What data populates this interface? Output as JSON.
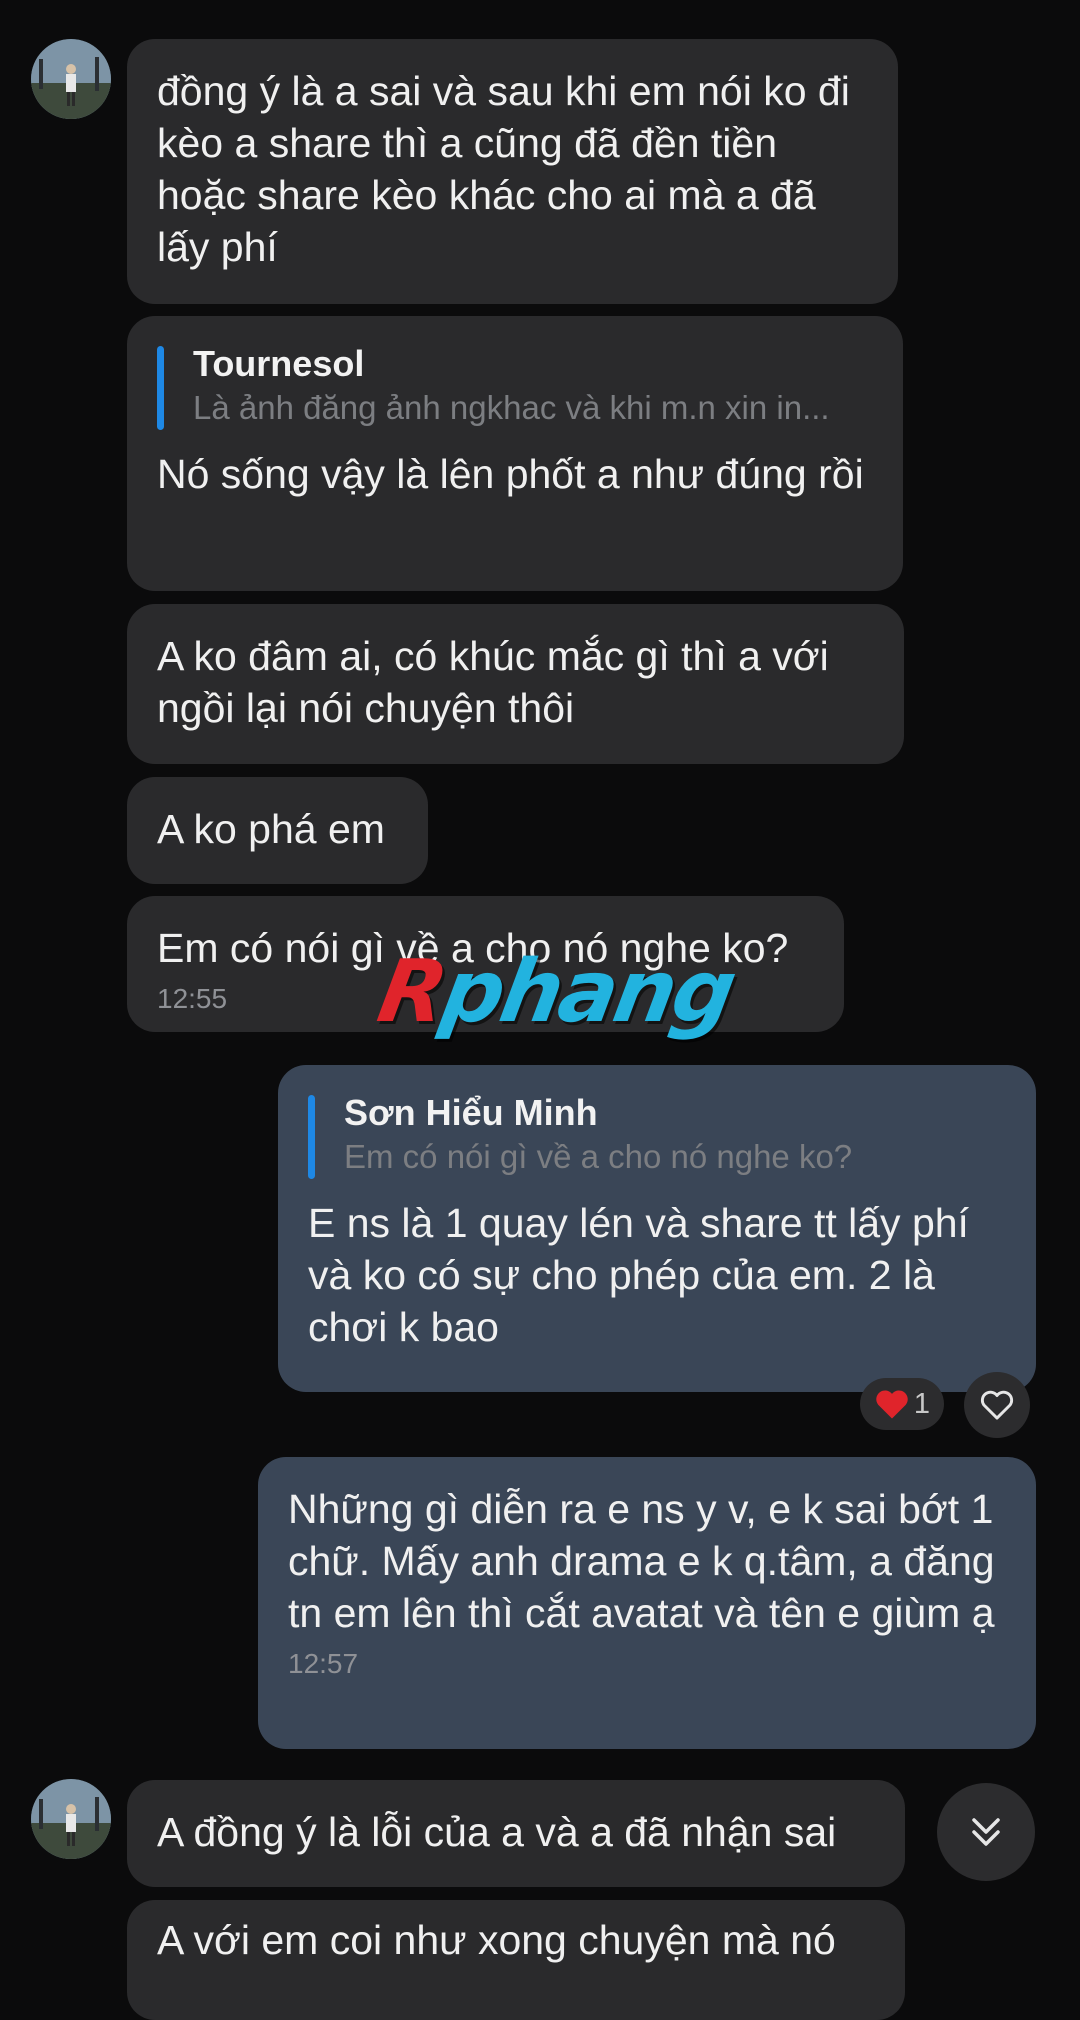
{
  "messages": [
    {
      "text": "đồng ý là a sai và sau khi em nói ko đi kèo a share thì a cũng đã đền tiền hoặc share kèo khác cho ai mà a đã lấy phí"
    },
    {
      "quote_name": "Tournesol",
      "quote_text": "Là ảnh đăng ảnh ngkhac và khi m.n xin in...",
      "text": "Nó sống vậy là lên phốt a như đúng rồi"
    },
    {
      "text": "A ko đâm ai, có khúc mắc gì thì a với ngồi lại nói chuyện thôi"
    },
    {
      "text": "A ko phá em"
    },
    {
      "text": "Em có nói gì về a cho nó nghe ko?",
      "time": "12:55"
    },
    {
      "quote_name": "Sơn Hiểu Minh",
      "quote_text": "Em có nói gì về a cho nó nghe ko?",
      "text": "E ns là 1 quay lén và share tt lấy phí và ko có sự cho phép của em. 2 là chơi k bao"
    },
    {
      "text": "Những gì diễn ra e ns y v, e k sai bớt 1 chữ. Mấy anh drama e k q.tâm, a đăng tn em lên thì cắt avatat và tên e giùm ạ",
      "time": "12:57"
    },
    {
      "text": "A đồng ý là lỗi của a và a đã nhận sai"
    },
    {
      "text": "A với em coi như xong chuyện mà nó"
    }
  ],
  "reaction": {
    "count": "1",
    "icon": "heart-icon",
    "color": "#e0242b"
  },
  "watermark": {
    "part1": "R",
    "part2": "phang"
  },
  "colors": {
    "background": "#0b0b0c",
    "incoming_bubble": "#2a2a2c",
    "outgoing_bubble": "#3a4657",
    "quote_bar": "#1e88e5"
  }
}
